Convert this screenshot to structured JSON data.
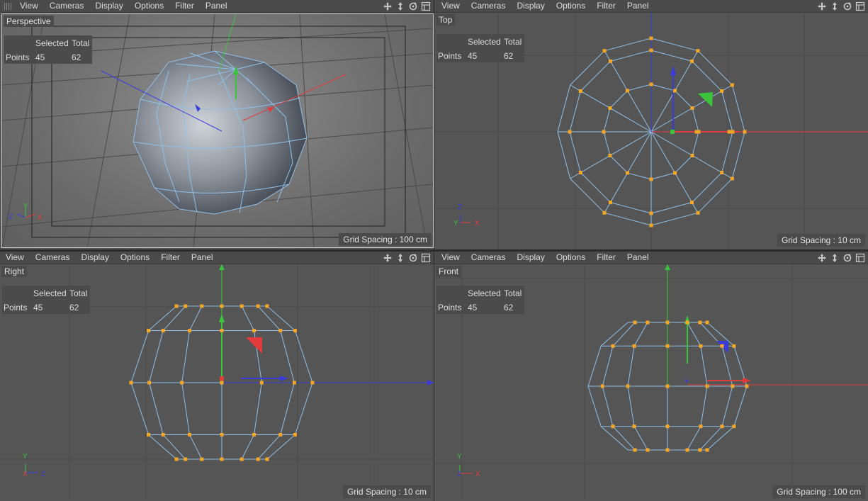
{
  "menu": [
    "View",
    "Cameras",
    "Display",
    "Options",
    "Filter",
    "Panel"
  ],
  "nav_icons": [
    "move-view-icon",
    "zoom-view-icon",
    "rotate-view-icon",
    "toggle-layout-icon"
  ],
  "stats": {
    "selected_label": "Selected",
    "total_label": "Total",
    "row_label": "Points",
    "selected": "45",
    "total": "62"
  },
  "viewports": [
    {
      "camera": "Perspective",
      "grid_spacing": "Grid Spacing : 100 cm"
    },
    {
      "camera": "Top",
      "grid_spacing": "Grid Spacing : 10 cm"
    },
    {
      "camera": "Right",
      "grid_spacing": "Grid Spacing : 10 cm"
    },
    {
      "camera": "Front",
      "grid_spacing": "Grid Spacing : 100 cm"
    }
  ],
  "axis_labels": {
    "x": "X",
    "y": "Y",
    "z": "Z"
  },
  "colors": {
    "background": "#555555",
    "mesh": "#8fc0e8",
    "point": "#f5a623",
    "axis_x": "#e23b3b",
    "axis_y": "#3cc43c",
    "axis_z": "#3b3bdc"
  }
}
